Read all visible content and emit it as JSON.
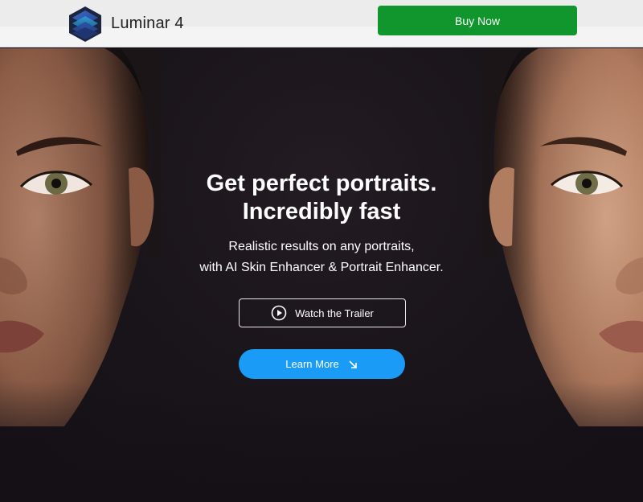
{
  "header": {
    "brand": "Luminar 4",
    "buy_label": "Buy Now"
  },
  "hero": {
    "headline_line1": "Get perfect portraits.",
    "headline_line2": "Incredibly fast",
    "subline_line1": "Realistic results on any portraits,",
    "subline_line2": "with AI Skin Enhancer & Portrait Enhancer.",
    "trailer_label": "Watch the Trailer",
    "learn_label": "Learn More"
  },
  "icons": {
    "logo": "luminar-cube-logo",
    "play": "play-circle-icon",
    "arrow": "arrow-down-right-icon"
  },
  "colors": {
    "buy_button": "#10962c",
    "learn_button": "#1a9bf5",
    "hero_bg": "#15111a",
    "header_bg": "#f4f4f4"
  }
}
